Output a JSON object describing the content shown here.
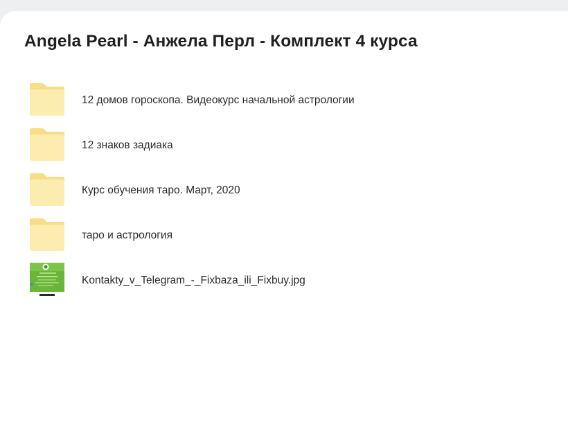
{
  "page": {
    "title": "Angela Pearl - Анжела Перл - Комплект 4 курса"
  },
  "items": [
    {
      "type": "folder",
      "icon": "folder-icon",
      "name": "12 домов гороскопа. Видеокурс начальной астрологии"
    },
    {
      "type": "folder",
      "icon": "folder-icon",
      "name": "12 знаков задиака"
    },
    {
      "type": "folder",
      "icon": "folder-icon",
      "name": "Курс обучения таро. Март, 2020"
    },
    {
      "type": "folder",
      "icon": "folder-icon",
      "name": "таро и астрология"
    },
    {
      "type": "image",
      "icon": "image-thumbnail",
      "name": "Kontakty_v_Telegram_-_Fixbaza_ili_Fixbuy.jpg"
    }
  ],
  "colors": {
    "folder_back": "#f6dd86",
    "folder_front": "#fdecb0",
    "thumb_green": "#6bb53a"
  }
}
